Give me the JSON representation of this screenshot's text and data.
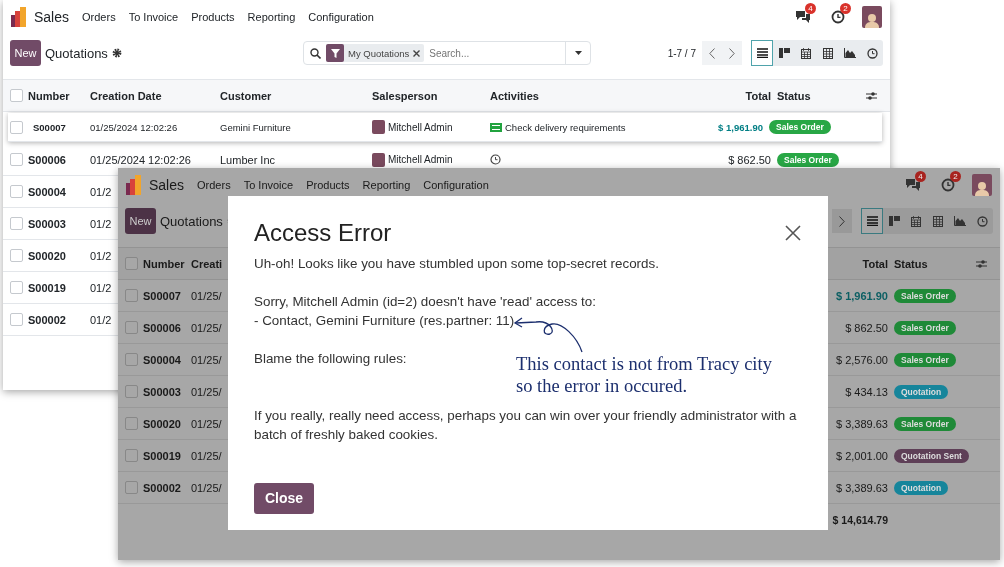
{
  "back_window": {
    "nav": {
      "app": "Sales",
      "menu": [
        "Orders",
        "To Invoice",
        "Products",
        "Reporting",
        "Configuration"
      ],
      "messages_badge": "4",
      "activities_badge": "2"
    },
    "control": {
      "new_button": "New",
      "title": "Quotations",
      "filter": "My Quotations",
      "search_placeholder": "Search...",
      "pager": "1-7 / 7",
      "pager_buttons": [
        {
          "kind": "prev"
        },
        {
          "kind": "next"
        }
      ]
    },
    "views": [
      {
        "kind": "list",
        "selected": true
      },
      {
        "kind": "kanban",
        "selected": false
      },
      {
        "kind": "calendar",
        "selected": false
      },
      {
        "kind": "pivot",
        "selected": false
      },
      {
        "kind": "graph",
        "selected": false
      },
      {
        "kind": "activity",
        "selected": false
      }
    ],
    "table": {
      "header_checked": false,
      "columns": [
        {
          "kind": "number",
          "label": "Number"
        },
        {
          "kind": "date",
          "label": "Creation Date"
        },
        {
          "kind": "customer",
          "label": "Customer"
        },
        {
          "kind": "salesperson",
          "label": "Salesperson"
        },
        {
          "kind": "activities",
          "label": "Activities"
        },
        {
          "kind": "total",
          "label": "Total"
        },
        {
          "kind": "status",
          "label": "Status"
        }
      ],
      "rows": [
        {
          "number": "S00007",
          "date": "01/25/2024 12:02:26",
          "customer": "Gemini Furniture",
          "salesperson": "Mitchell Admin",
          "activity": {
            "kind": "task",
            "text": "Check delivery requirements"
          },
          "total": "$ 1,961.90",
          "status": "Sales Order",
          "color": "#28a745",
          "selected": true,
          "checked": false
        },
        {
          "number": "S00006",
          "date": "01/25/2024 12:02:26",
          "customer": "Lumber Inc",
          "salesperson": "Mitchell Admin",
          "activity": {
            "kind": "clock"
          },
          "total": "$ 862.50",
          "status": "Sales Order",
          "color": "#28a745",
          "selected": false,
          "checked": false
        },
        {
          "number": "S00004",
          "date": "01/2",
          "selected": false,
          "checked": false
        },
        {
          "number": "S00003",
          "date": "01/2",
          "selected": false,
          "checked": false
        },
        {
          "number": "S00020",
          "date": "01/2",
          "selected": false,
          "checked": false
        },
        {
          "number": "S00019",
          "date": "01/2",
          "selected": false,
          "checked": false
        },
        {
          "number": "S00002",
          "date": "01/2",
          "selected": false,
          "checked": false
        }
      ]
    }
  },
  "front_window": {
    "nav": {
      "app": "Sales",
      "menu": [
        "Orders",
        "To Invoice",
        "Products",
        "Reporting",
        "Configuration"
      ],
      "messages_badge": "4",
      "activities_badge": "2"
    },
    "control": {
      "new_button": "New",
      "title": "Quotations",
      "pager_buttons": [
        {
          "kind": "next"
        }
      ]
    },
    "views": [
      {
        "kind": "list",
        "selected": true
      },
      {
        "kind": "kanban",
        "selected": false
      },
      {
        "kind": "calendar",
        "selected": false
      },
      {
        "kind": "pivot",
        "selected": false
      },
      {
        "kind": "graph",
        "selected": false
      },
      {
        "kind": "activity",
        "selected": false
      }
    ],
    "table": {
      "header_checked": false,
      "columns": [
        {
          "kind": "number",
          "label": "Number"
        },
        {
          "kind": "date",
          "label": "Creati"
        },
        {
          "kind": "total",
          "label": "Total"
        },
        {
          "kind": "status",
          "label": "Status"
        }
      ],
      "rows": [
        {
          "number": "S00007",
          "date": "01/25/",
          "total": "$ 1,961.90",
          "status": "Sales Order",
          "color": "#1f8a38",
          "selected": true,
          "checked": false
        },
        {
          "number": "S00006",
          "date": "01/25/",
          "total": "$ 862.50",
          "status": "Sales Order",
          "color": "#1f8a38",
          "selected": false,
          "checked": false
        },
        {
          "number": "S00004",
          "date": "01/25/",
          "total": "$ 2,576.00",
          "status": "Sales Order",
          "color": "#1f8a38",
          "selected": false,
          "checked": false
        },
        {
          "number": "S00003",
          "date": "01/25/",
          "total": "$ 434.13",
          "status": "Quotation",
          "color": "#16859b",
          "selected": false,
          "checked": false
        },
        {
          "number": "S00020",
          "date": "01/25/",
          "total": "$ 3,389.63",
          "status": "Sales Order",
          "color": "#1f8a38",
          "selected": false,
          "checked": false
        },
        {
          "number": "S00019",
          "date": "01/25/",
          "total": "$ 2,001.00",
          "status": "Quotation Sent",
          "color": "#5e3f57",
          "selected": false,
          "checked": false
        },
        {
          "number": "S00002",
          "date": "01/25/",
          "total": "$ 3,389.63",
          "status": "Quotation",
          "color": "#16859b",
          "selected": false,
          "checked": false
        }
      ],
      "footer_total": "$ 14,614.79"
    }
  },
  "dialog": {
    "title": "Access Error",
    "intro": "Uh-oh! Looks like you have stumbled upon some top-secret records.",
    "access_lines": [
      "Sorry, Mitchell Admin (id=2) doesn't have 'read' access to:",
      "- Contact, Gemini Furniture (res.partner: 11)"
    ],
    "rules": "Blame the following rules:",
    "advice": "If you really, really need access, perhaps you can win over your friendly administrator with a batch of freshly baked cookies.",
    "close_button": "Close"
  },
  "annotation": {
    "lines": [
      "This contact is not from Tracy city",
      "so the error in occured."
    ]
  }
}
